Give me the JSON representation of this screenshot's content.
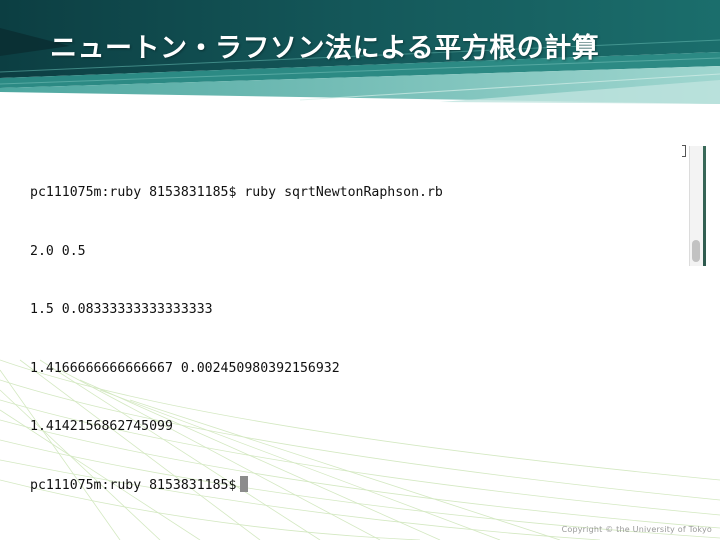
{
  "slide": {
    "title": "ニュートン・ラフソン法による平方根の計算",
    "copyright": "Copyright © the University of Tokyo"
  },
  "terminal": {
    "lines": [
      "pc111075m:ruby 8153831185$ ruby sqrtNewtonRaphson.rb",
      "2.0 0.5",
      "1.5 0.08333333333333333",
      "1.4166666666666667 0.002450980392156932",
      "1.4142156862745099"
    ],
    "prompt": "pc111075m:ruby 8153831185$"
  },
  "colors": {
    "banner_dark": "#0f4a4c",
    "banner_mid": "#1f7a78",
    "banner_light": "#6fbfb8",
    "deco_lines": "#c8e0b0"
  }
}
